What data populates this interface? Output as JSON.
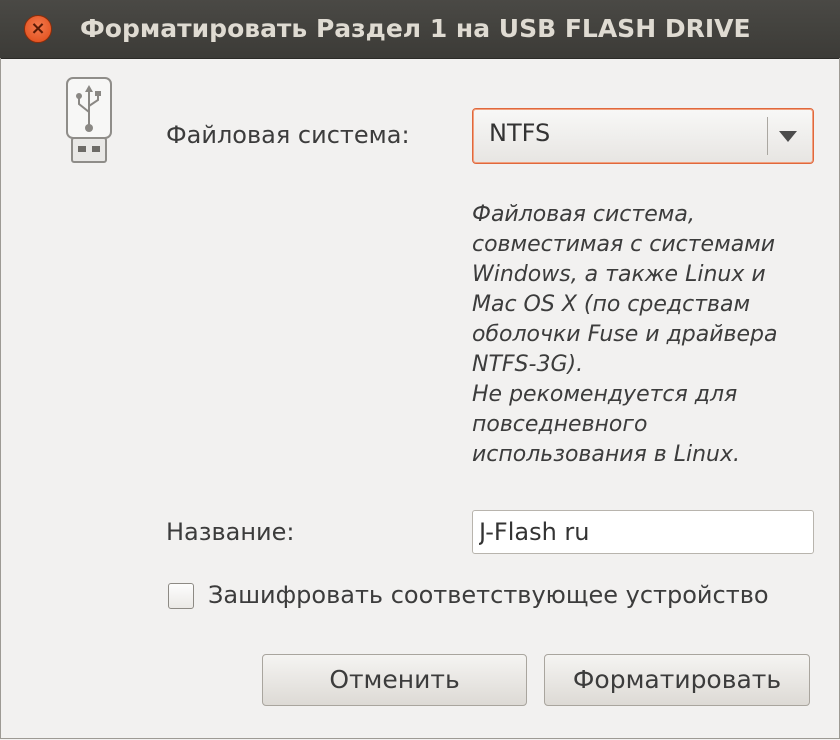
{
  "window": {
    "title": "Форматировать Раздел 1 на USB FLASH DRIVE",
    "close_glyph": "×"
  },
  "icons": {
    "device": "usb-flash-drive-icon"
  },
  "form": {
    "filesystem_label": "Файловая система:",
    "filesystem_value": "NTFS",
    "filesystem_description": "Файловая система,\nсовместимая с системами\nWindows, а также Linux и\nMac OS X (по средствам\nоболочки Fuse и драйвера\nNTFS-3G).\nНе рекомендуется для\nповседневного\nиспользования в Linux.",
    "name_label": "Название:",
    "name_value": "J-Flash ru",
    "encrypt_label": "Зашифровать соответствующее устройство",
    "encrypt_checked": false
  },
  "buttons": {
    "cancel": "Отменить",
    "format": "Форматировать"
  },
  "colors": {
    "titlebar": "#3c3b37",
    "close": "#df4a16",
    "focus": "#e0683c",
    "background": "#f2f1f0"
  }
}
